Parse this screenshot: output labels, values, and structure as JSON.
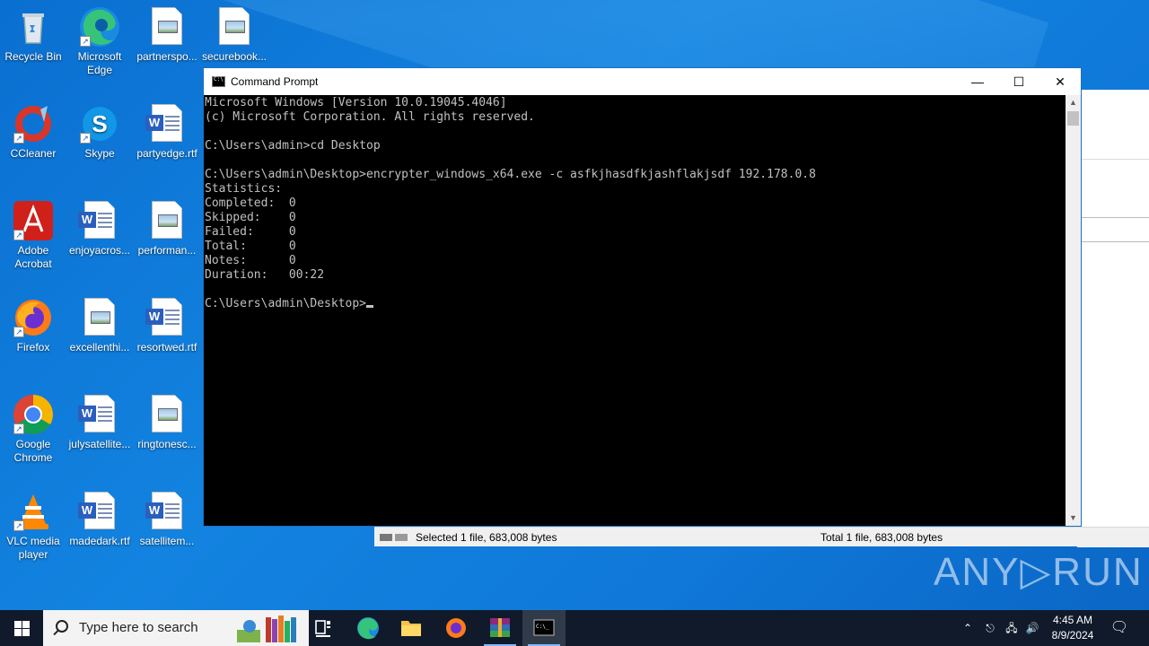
{
  "desktop": {
    "icons": [
      {
        "label": "Recycle Bin",
        "icon": "recycle-bin-icon"
      },
      {
        "label": "Microsoft Edge",
        "icon": "edge-icon"
      },
      {
        "label": "partnerspo...",
        "icon": "image-file-icon"
      },
      {
        "label": "securebook...",
        "icon": "image-file-icon"
      },
      {
        "label": "CCleaner",
        "icon": "ccleaner-icon"
      },
      {
        "label": "Skype",
        "icon": "skype-icon"
      },
      {
        "label": "partyedge.rtf",
        "icon": "word-doc-icon"
      },
      {
        "label": "Adobe Acrobat",
        "icon": "acrobat-icon"
      },
      {
        "label": "enjoyacros...",
        "icon": "word-doc-icon"
      },
      {
        "label": "performan...",
        "icon": "image-file-icon"
      },
      {
        "label": "Firefox",
        "icon": "firefox-icon"
      },
      {
        "label": "excellenthi...",
        "icon": "image-file-icon"
      },
      {
        "label": "resortwed.rtf",
        "icon": "word-doc-icon"
      },
      {
        "label": "Google Chrome",
        "icon": "chrome-icon"
      },
      {
        "label": "julysatellite...",
        "icon": "word-doc-icon"
      },
      {
        "label": "ringtonesc...",
        "icon": "image-file-icon"
      },
      {
        "label": "VLC media player",
        "icon": "vlc-icon"
      },
      {
        "label": "madedark.rtf",
        "icon": "word-doc-icon"
      },
      {
        "label": "satellitem...",
        "icon": "word-doc-icon"
      }
    ]
  },
  "cmd": {
    "title": "Command Prompt",
    "minimize_glyph": "—",
    "maximize_glyph": "☐",
    "close_glyph": "✕",
    "lines": [
      "Microsoft Windows [Version 10.0.19045.4046]",
      "(c) Microsoft Corporation. All rights reserved.",
      "",
      "C:\\Users\\admin>cd Desktop",
      "",
      "C:\\Users\\admin\\Desktop>encrypter_windows_x64.exe -c asfkjhasdfkjashflakjsdf 192.178.0.8",
      "Statistics:",
      "Completed:  0",
      "Skipped:    0",
      "Failed:     0",
      "Total:      0",
      "Notes:      0",
      "Duration:   00:22",
      ""
    ],
    "prompt": "C:\\Users\\admin\\Desktop>"
  },
  "explorer": {
    "status_selected": "Selected 1 file, 683,008 bytes",
    "status_total": "Total 1 file, 683,008 bytes"
  },
  "watermark": "ANY▷RUN",
  "taskbar": {
    "search_placeholder": "Type here to search",
    "apps": [
      "task-view-icon",
      "edge-icon",
      "file-explorer-icon",
      "firefox-icon",
      "winrar-icon",
      "cmd-icon"
    ],
    "time": "4:45 AM",
    "date": "8/9/2024"
  },
  "colors": {
    "desktop": "#0f78d8",
    "console_bg": "#000000",
    "console_fg": "#c0c0c0",
    "taskbar": "#101a2a"
  }
}
